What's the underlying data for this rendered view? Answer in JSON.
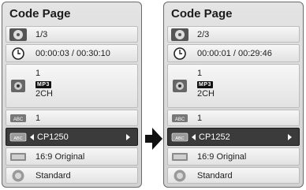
{
  "left": {
    "title": "Code Page",
    "rows": {
      "title_num": "1/3",
      "time": "00:00:03 / 00:30:10",
      "audio_line1": "1",
      "audio_badge": "MP3",
      "audio_line3": "2CH",
      "subtitle": "1",
      "codepage": "CP1250",
      "angle": "16:9 Original",
      "sound": "Standard"
    },
    "icons": {
      "title": "disc-title-icon",
      "time": "clock-icon",
      "audio": "audio-speaker-icon",
      "subtitle": "abc-subtitle-icon",
      "codepage": "abc-codepage-icon",
      "angle": "aspect-ratio-icon",
      "sound": "sound-mode-icon"
    }
  },
  "right": {
    "title": "Code Page",
    "rows": {
      "title_num": "2/3",
      "time": "00:00:01 / 00:29:46",
      "audio_line1": "1",
      "audio_badge": "MP3",
      "audio_line3": "2CH",
      "subtitle": "1",
      "codepage": "CP1252",
      "angle": "16:9 Original",
      "sound": "Standard"
    }
  },
  "colors": {
    "selected_row": "#3b3b3b",
    "panel_bg": "#dcdcdc",
    "arrow": "#111111"
  },
  "transition_icon": "right-arrow-icon"
}
